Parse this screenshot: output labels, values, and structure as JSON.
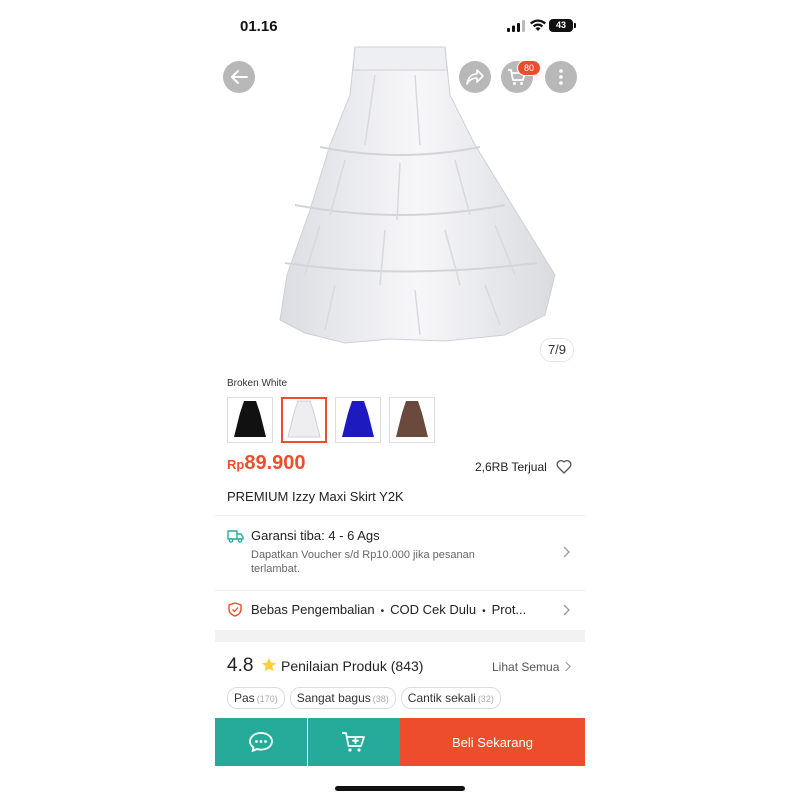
{
  "status_bar": {
    "time": "01.16",
    "battery": "43"
  },
  "gallery": {
    "counter": "7/9",
    "cart_badge": "80"
  },
  "variant": {
    "selected_label": "Broken White",
    "options": [
      {
        "color": "#111111"
      },
      {
        "color": "#f0f0f2"
      },
      {
        "color": "#1d1bc0"
      },
      {
        "color": "#6b4a3e"
      }
    ],
    "selected_index": 1
  },
  "product": {
    "currency": "Rp",
    "price": "89.900",
    "sold": "2,6RB Terjual",
    "title": "PREMIUM Izzy Maxi Skirt Y2K"
  },
  "shipping": {
    "title": "Garansi tiba: 4 - 6 Ags",
    "subtitle": "Dapatkan Voucher s/d Rp10.000 jika pesanan terlambat."
  },
  "services": {
    "items": [
      "Bebas Pengembalian",
      "COD Cek Dulu",
      "Prot..."
    ]
  },
  "ratings": {
    "score": "4.8",
    "label": "Penilaian Produk",
    "count": "(843)",
    "see_all": "Lihat Semua",
    "chips": [
      {
        "label": "Pas",
        "count": "(170)"
      },
      {
        "label": "Sangat bagus",
        "count": "(38)"
      },
      {
        "label": "Cantik sekali",
        "count": "(32)"
      }
    ]
  },
  "bottom_bar": {
    "buy_label": "Beli Sekarang"
  },
  "colors": {
    "accent": "#ee4d2d",
    "teal": "#26aa99"
  }
}
